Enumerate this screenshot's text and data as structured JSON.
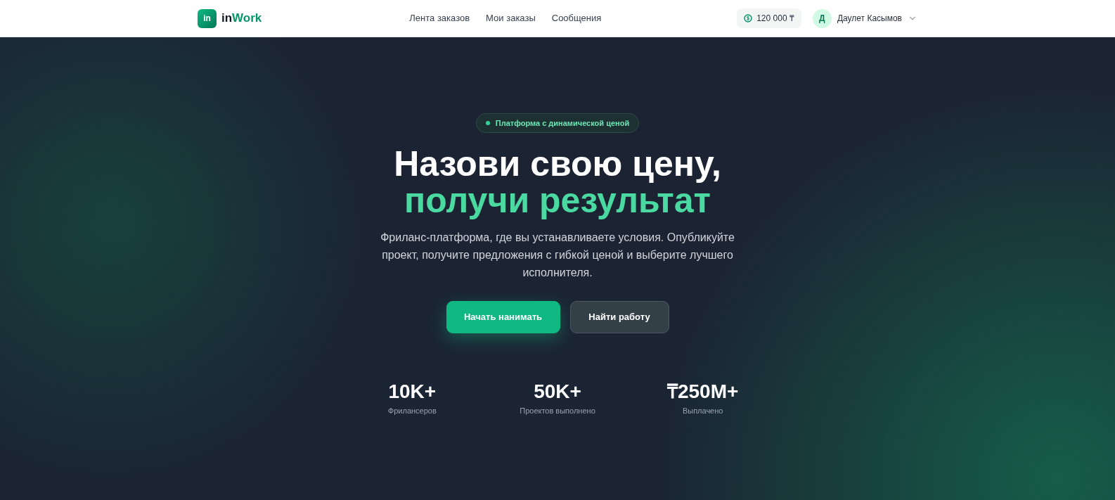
{
  "header": {
    "logo_mark": "in",
    "logo_text_dark": "in",
    "logo_text_accent": "Work",
    "nav": [
      {
        "label": "Лента заказов"
      },
      {
        "label": "Мои заказы"
      },
      {
        "label": "Сообщения"
      }
    ],
    "balance": "120 000 ₸",
    "user": {
      "initial": "Д",
      "name": "Даулет Касымов"
    }
  },
  "hero": {
    "badge": "Платформа с динамической ценой",
    "title_line1": "Назови свою цену,",
    "title_line2": "получи результат",
    "subtitle": "Фриланс-платформа, где вы устанавливаете условия. Опубликуйте проект, получите предложения с гибкой ценой и выберите лучшего исполнителя.",
    "buttons": [
      {
        "label": "Начать нанимать",
        "kind": "primary"
      },
      {
        "label": "Найти работу",
        "kind": "secondary"
      }
    ],
    "stats": [
      {
        "value": "10K+",
        "label": "Фрилансеров"
      },
      {
        "value": "50K+",
        "label": "Проектов выполнено"
      },
      {
        "value": "₸250M+",
        "label": "Выплачено"
      }
    ]
  }
}
